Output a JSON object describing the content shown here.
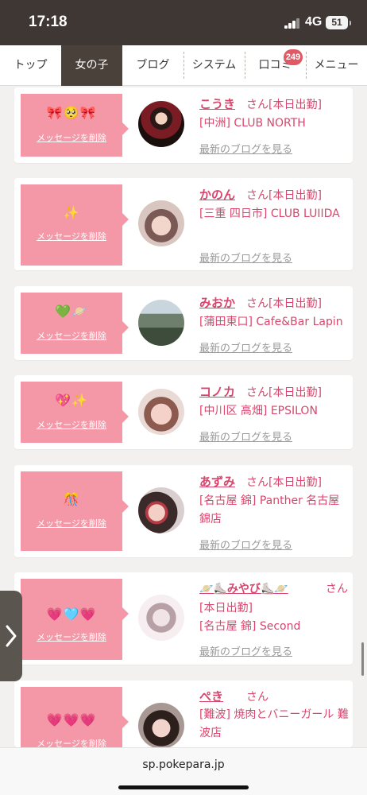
{
  "status": {
    "time": "17:18",
    "network": "4G",
    "battery": "51"
  },
  "nav": {
    "items": [
      "トップ",
      "女の子",
      "ブログ",
      "システム",
      "口コミ",
      "メニュー"
    ],
    "badge": "249"
  },
  "common": {
    "delete_label": "メッセージを削除",
    "blog_label": "最新のブログを見る",
    "san": "さん"
  },
  "girls": [
    {
      "name": "こうき",
      "after_name": "さん[本日出勤]",
      "shop": "[中洲] CLUB NORTH",
      "emoji": "🎀🥺🎀"
    },
    {
      "name": "かのん",
      "after_name": "さん[本日出勤]",
      "shop": "[三重 四日市] CLUB LUIIDA",
      "emoji": "✨"
    },
    {
      "name": "みおか",
      "after_name": "さん[本日出勤]",
      "shop": "[蒲田東口] Cafe&Bar Lapin",
      "emoji": "💚🪐"
    },
    {
      "name": "コノカ",
      "after_name": "さん[本日出勤]",
      "shop": "[中川区 高畑] EPSILON",
      "emoji": "💖✨"
    },
    {
      "name": "あずみ",
      "after_name": "さん[本日出勤]",
      "shop": "[名古屋 錦] Panther 名古屋錦店",
      "emoji": "🎊"
    },
    {
      "name": "🪐⛸️みやび⛸️🪐",
      "after_name": "さん",
      "status": "[本日出勤]",
      "shop": "[名古屋 錦] Second",
      "emoji": "💗🩵💗"
    },
    {
      "name": "ぺき",
      "after_name": "さん",
      "shop": "[難波] 焼肉とバニーガール 難波店",
      "emoji": "💗💗💗"
    }
  ],
  "url": "sp.pokepara.jp"
}
